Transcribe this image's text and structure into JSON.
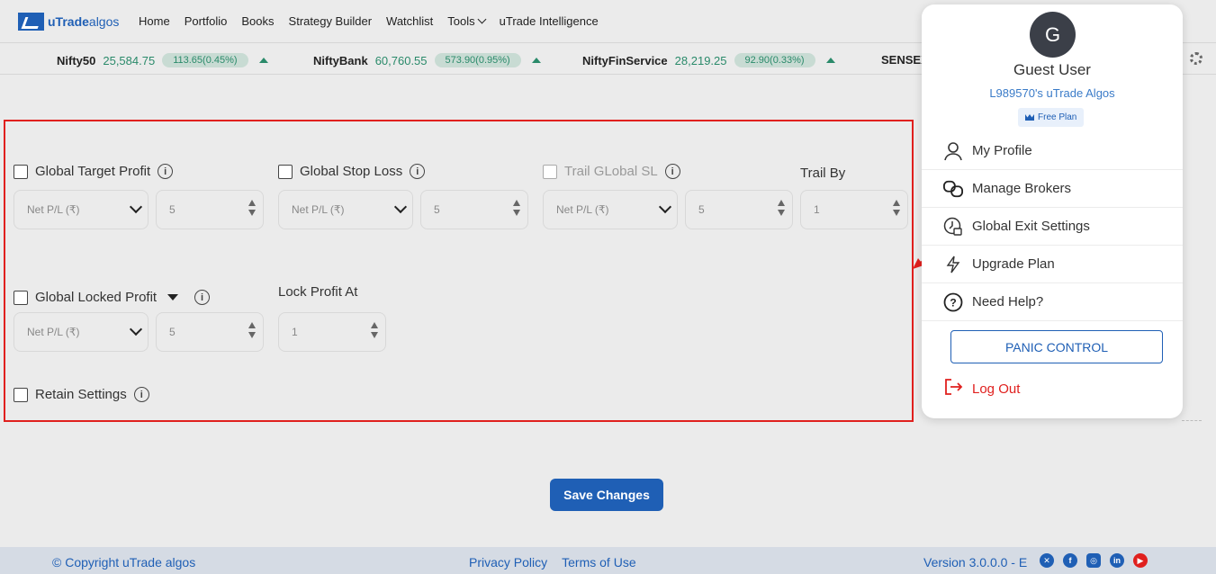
{
  "brand": {
    "name_bold": "uTrade",
    "name_light": "algos"
  },
  "nav": [
    "Home",
    "Portfolio",
    "Books",
    "Strategy Builder",
    "Watchlist",
    "Tools",
    "uTrade Intelligence"
  ],
  "ticker": [
    {
      "name": "Nifty50",
      "value": "25,584.75",
      "change": "113.65(0.45%)"
    },
    {
      "name": "NiftyBank",
      "value": "60,760.55",
      "change": "573.90(0.95%)"
    },
    {
      "name": "NiftyFinService",
      "value": "28,219.25",
      "change": "92.90(0.33%)"
    },
    {
      "name": "SENSEX"
    }
  ],
  "form": {
    "target_profit_label": "Global Target Profit",
    "stop_loss_label": "Global Stop Loss",
    "trail_sl_label": "Trail GLobal SL",
    "trail_by_label": "Trail By",
    "locked_profit_label": "Global Locked Profit",
    "lock_profit_at_label": "Lock Profit At",
    "retain_label": "Retain Settings",
    "select_placeholder": "Net P/L (₹)",
    "num_5": "5",
    "num_1": "1",
    "info_glyph": "i"
  },
  "save_label": "Save Changes",
  "footer": {
    "copyright": "© Copyright uTrade algos",
    "privacy": "Privacy Policy",
    "terms": "Terms of Use",
    "version": "Version 3.0.0.0 - E"
  },
  "user": {
    "initial": "G",
    "name": "Guest User",
    "account": "L989570's uTrade Algos",
    "plan": "Free Plan"
  },
  "menu": {
    "profile": "My Profile",
    "brokers": "Manage Brokers",
    "exit": "Global Exit Settings",
    "upgrade": "Upgrade Plan",
    "help": "Need Help?",
    "panic": "PANIC CONTROL",
    "logout": "Log Out"
  },
  "colors": {
    "accent": "#1f5fb5",
    "positive": "#2a8a6a",
    "highlight": "#e0201e"
  },
  "icons": {
    "social": [
      "x-icon",
      "facebook-icon",
      "instagram-icon",
      "linkedin-icon",
      "youtube-icon"
    ]
  }
}
